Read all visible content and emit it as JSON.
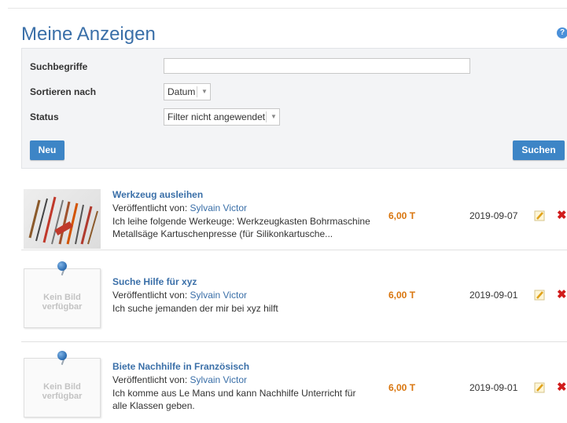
{
  "page": {
    "title": "Meine Anzeigen",
    "help_icon": "?"
  },
  "filter": {
    "search_label": "Suchbegriffe",
    "search_value": "",
    "sort_label": "Sortieren nach",
    "sort_value": "Datum",
    "status_label": "Status",
    "status_value": "Filter nicht angewendet",
    "new_button": "Neu",
    "search_button": "Suchen"
  },
  "listings": [
    {
      "title": "Werkzeug ausleihen",
      "published_label": "Veröffentlicht von:",
      "author": "Sylvain Victor",
      "description": "Ich leihe folgende Werkeuge: Werkzeugkasten Bohrmaschine Metallsäge Kartuschenpresse (für Silikonkartusche...",
      "price": "6,00 T",
      "date": "2019-09-07",
      "has_image": true
    },
    {
      "title": "Suche Hilfe für xyz",
      "published_label": "Veröffentlicht von:",
      "author": "Sylvain Victor",
      "description": "Ich suche jemanden der mir bei xyz hilft",
      "price": "6,00 T",
      "date": "2019-09-01",
      "has_image": false,
      "placeholder_text": "Kein Bild verfügbar"
    },
    {
      "title": "Biete Nachhilfe in Französisch",
      "published_label": "Veröffentlicht von:",
      "author": "Sylvain Victor",
      "description": "Ich komme aus Le Mans und kann Nachhilfe Unterricht für alle Klassen geben.",
      "price": "6,00 T",
      "date": "2019-09-01",
      "has_image": false,
      "placeholder_text": "Kein Bild verfügbar"
    }
  ],
  "icons": {
    "edit": "pencil-edit-icon",
    "delete": "red-x-delete-icon"
  },
  "colors": {
    "link": "#3a6fa8",
    "button": "#3d85c6",
    "price": "#d9750d",
    "delete": "#d11b1b"
  }
}
